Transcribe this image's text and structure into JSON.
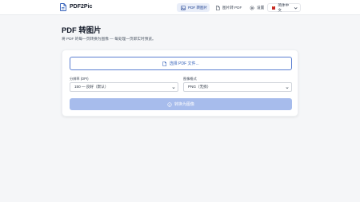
{
  "brand": {
    "name": "PDF2Pic"
  },
  "nav": {
    "pdf_to_image": "PDF 转图片",
    "image_to_pdf": "图片转 PDF",
    "settings": "设置",
    "language": "简体中文"
  },
  "page": {
    "title": "PDF 转图片",
    "subtitle": "将 PDF 的每一页转换为图像 — 每处理一页即实时预览。"
  },
  "form": {
    "select_file_label": "选择 PDF 文件...",
    "dpi_label": "分辨率 (DPI)",
    "dpi_value": "150 — 良好（默认）",
    "format_label": "图像格式",
    "format_value": "PNG（无损）",
    "convert_label": "转换为图像"
  },
  "colors": {
    "accent": "#2f5db8",
    "button_disabled": "#a7bcec",
    "active_nav_bg": "#e9eef9"
  }
}
